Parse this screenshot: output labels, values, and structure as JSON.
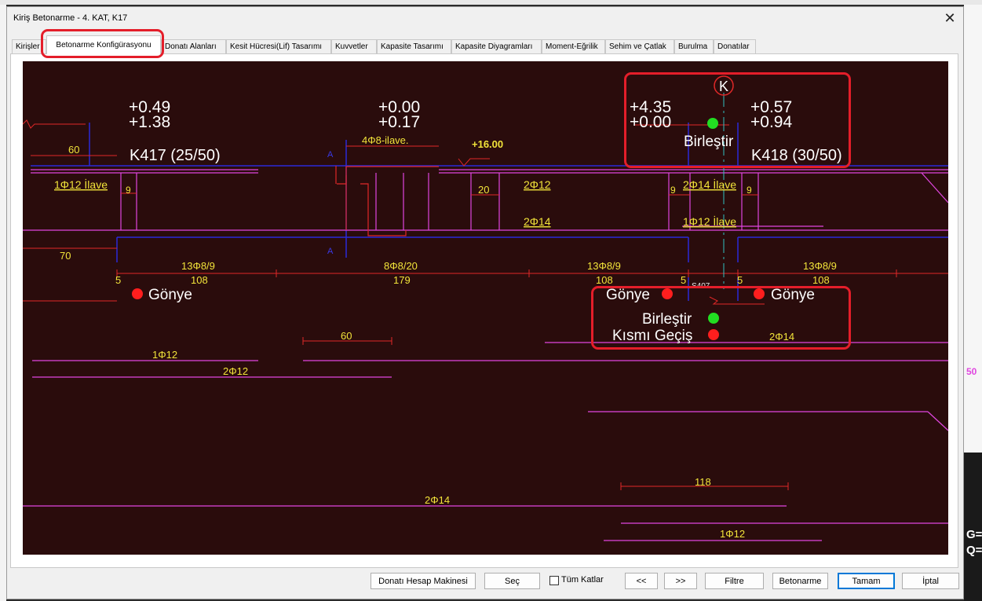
{
  "window": {
    "title": "Kiriş Betonarme - 4. KAT, K17",
    "close_glyph": "✕"
  },
  "tabs": [
    {
      "label": "Kirişler"
    },
    {
      "label": "Betonarme Konfigürasyonu"
    },
    {
      "label": "Donatı Alanları"
    },
    {
      "label": "Kesit Hücresi(Lif) Tasarımı"
    },
    {
      "label": "Kuvvetler"
    },
    {
      "label": "Kapasite Tasarımı"
    },
    {
      "label": "Kapasite Diyagramları"
    },
    {
      "label": "Moment-Eğrilik"
    },
    {
      "label": "Sehim ve Çatlak"
    },
    {
      "label": "Burulma"
    },
    {
      "label": "Donatılar"
    }
  ],
  "active_tab": "Betonarme Konfigürasyonu",
  "drawing": {
    "axis_label": "K",
    "left_values": [
      "+0.49",
      "+1.38"
    ],
    "mid_values": [
      "+0.00",
      "+0.17"
    ],
    "right_values_left": [
      "+4.35",
      "+0.00"
    ],
    "right_values_right": [
      "+0.57",
      "+0.94"
    ],
    "level_mark": "+16.00",
    "beam_left": "K417 (25/50)",
    "beam_right": "K418 (30/50)",
    "labels": {
      "len_60_top": "60",
      "ilave_4phi8": "4Φ8-ilave.",
      "ilave_left": "1Φ12 İlave",
      "nine_a": "9",
      "twenty": "20",
      "top_2phi12": "2Φ12",
      "top_2phi14": "2Φ14",
      "nine_b": "9",
      "ilave_2phi14": "2Φ14 İlave",
      "nine_c": "9",
      "ilave_1phi12": "1Φ12 İlave",
      "seventy": "70",
      "stir_1": "13Φ8/9",
      "stir_2": "8Φ8/20",
      "stir_3": "13Φ8/9",
      "stir_4": "13Φ8/9",
      "five_a": "5",
      "len_108_a": "108",
      "len_179": "179",
      "len_108_b": "108",
      "five_b": "5",
      "s407": "S407",
      "five_c": "5",
      "len_108_c": "108",
      "len_60_mid": "60",
      "bot_1phi12": "1Φ12",
      "bot_2phi12": "2Φ12",
      "bot_2phi14_r": "2Φ14",
      "len_118": "118",
      "bot_2phi14": "2Φ14",
      "bot_1phi12_b": "1Φ12",
      "a_top": "A",
      "a_bot": "A"
    },
    "markers": {
      "gonye_left": "Gönye",
      "gonye_mid": "Gönye",
      "gonye_right": "Gönye",
      "birlestir_top": "Birleştir",
      "birlestir_bot": "Birleştir",
      "kismi_gecis": "Kısmı Geçiş"
    },
    "colors": {
      "background": "#2a0c0c",
      "rebar": "#e046e0",
      "dimension": "#e02828",
      "text_yellow": "#f2e43a",
      "beam_outline": "#2a2ad8",
      "marker_red": "#ff1e1e",
      "marker_green": "#22dd22",
      "highlight": "#e41e2a"
    }
  },
  "buttons": {
    "calculator": "Donatı Hesap Makinesi",
    "select": "Seç",
    "all_floors": "Tüm Katlar",
    "prev": "<<",
    "next": ">>",
    "filter": "Filtre",
    "concrete": "Betonarme",
    "ok": "Tamam",
    "cancel": "İptal"
  },
  "side_fragments": {
    "g": "G=",
    "q": "Q=",
    "n50": "50"
  }
}
